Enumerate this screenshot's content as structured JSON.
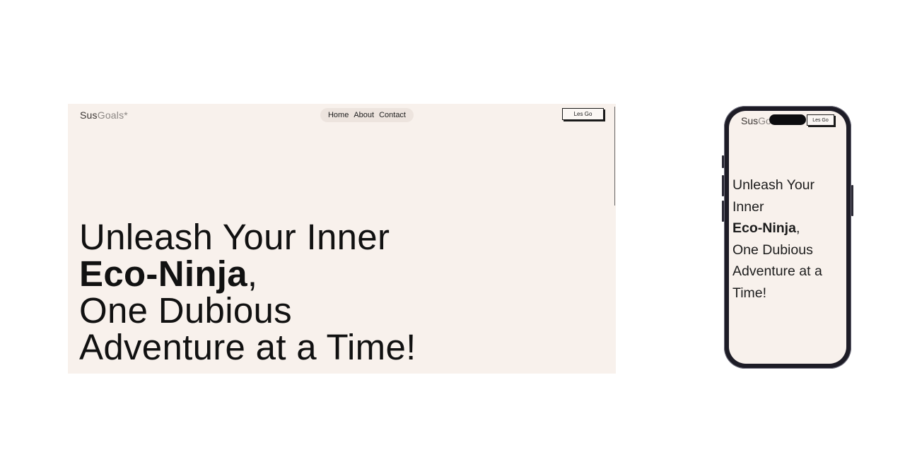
{
  "brand": {
    "strong": "Sus",
    "light": "Goals*"
  },
  "nav": {
    "items": [
      "Home",
      "About",
      "Contact"
    ]
  },
  "cta": {
    "label": "Les Go"
  },
  "hero": {
    "line1": "Unleash Your Inner",
    "bold": "Eco-Ninja",
    "comma": ",",
    "line3": "One Dubious",
    "line4": "Adventure at a Time!"
  },
  "mobile": {
    "brand_strong": "Sus",
    "brand_light": "Goals*",
    "cta_label": "Les Go",
    "hero_lines": [
      "Unleash Your",
      "Inner",
      "One Dubious",
      "Adventure at a",
      "Time!"
    ],
    "hero_bold": "Eco-Ninja",
    "hero_comma": ","
  },
  "colors": {
    "page_background": "#f8f1ec",
    "nav_pill": "#ede4de",
    "text": "#111111",
    "phone_frame": "#1d1c26"
  }
}
